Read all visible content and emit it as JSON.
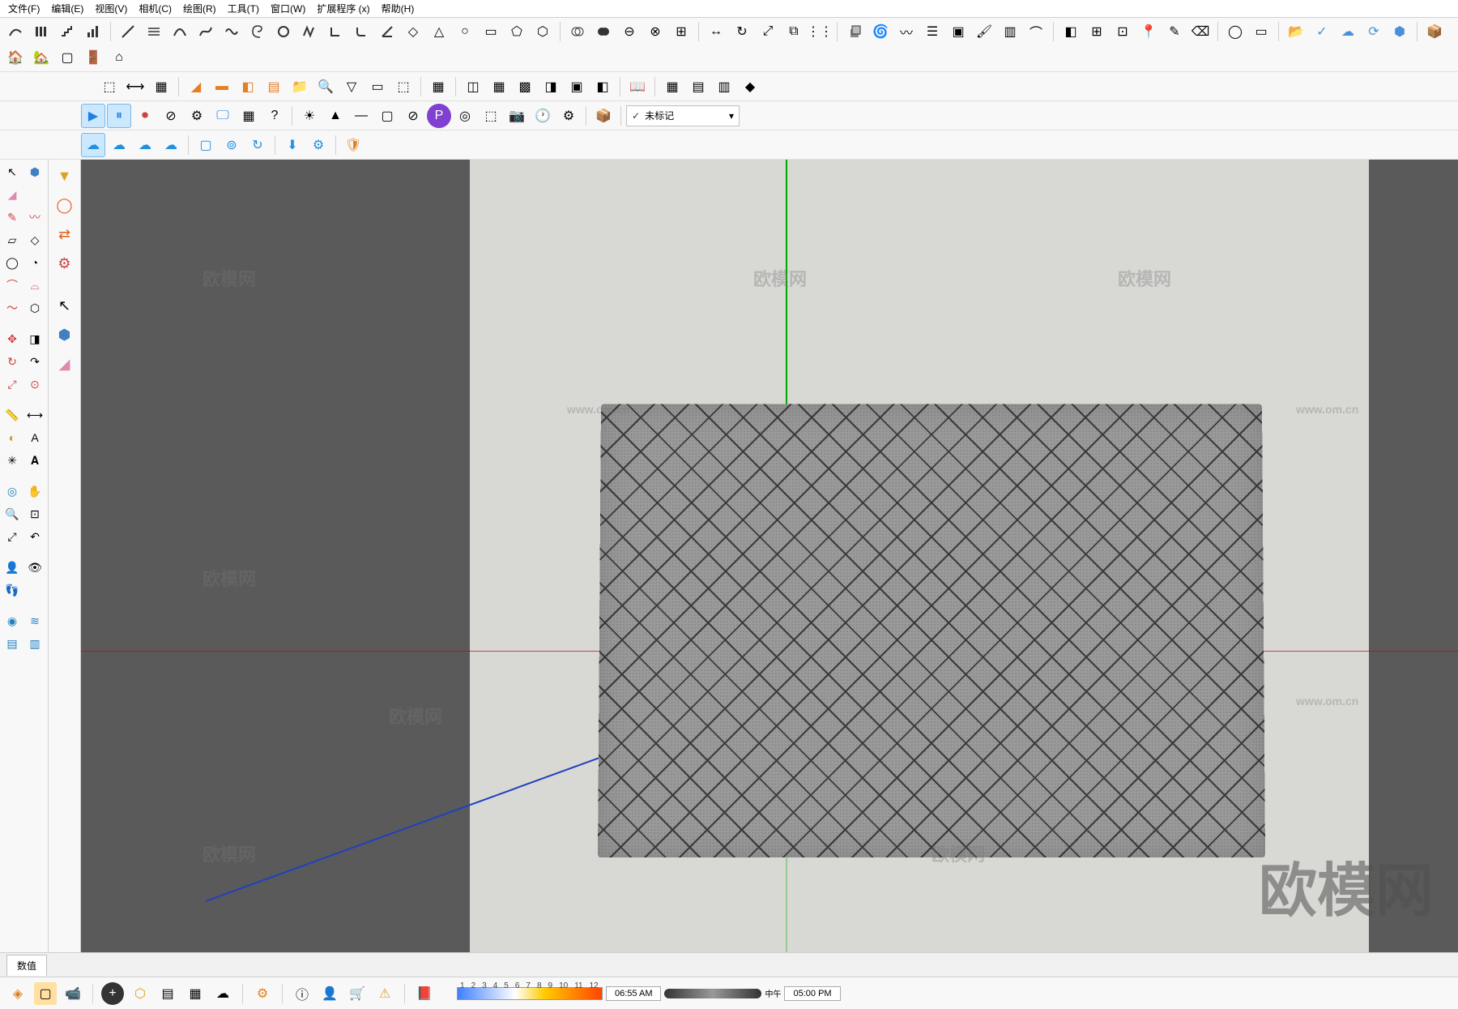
{
  "menu": {
    "file": "文件(F)",
    "edit": "编辑(E)",
    "view": "视图(V)",
    "camera": "相机(C)",
    "draw": "绘图(R)",
    "tools": "工具(T)",
    "window": "窗口(W)",
    "extensions": "扩展程序 (x)",
    "help": "帮助(H)"
  },
  "tag_dropdown": {
    "selected": "未标记",
    "check": "✓"
  },
  "status": {
    "label": "数值"
  },
  "timeline": {
    "numbers": [
      "1",
      "2",
      "3",
      "4",
      "5",
      "6",
      "7",
      "8",
      "9",
      "10",
      "11",
      "12"
    ],
    "start_time": "06:55 AM",
    "noon": "中午",
    "end_time": "05:00 PM"
  },
  "watermarks": {
    "brand": "欧模网",
    "url": "www.om.cn"
  }
}
